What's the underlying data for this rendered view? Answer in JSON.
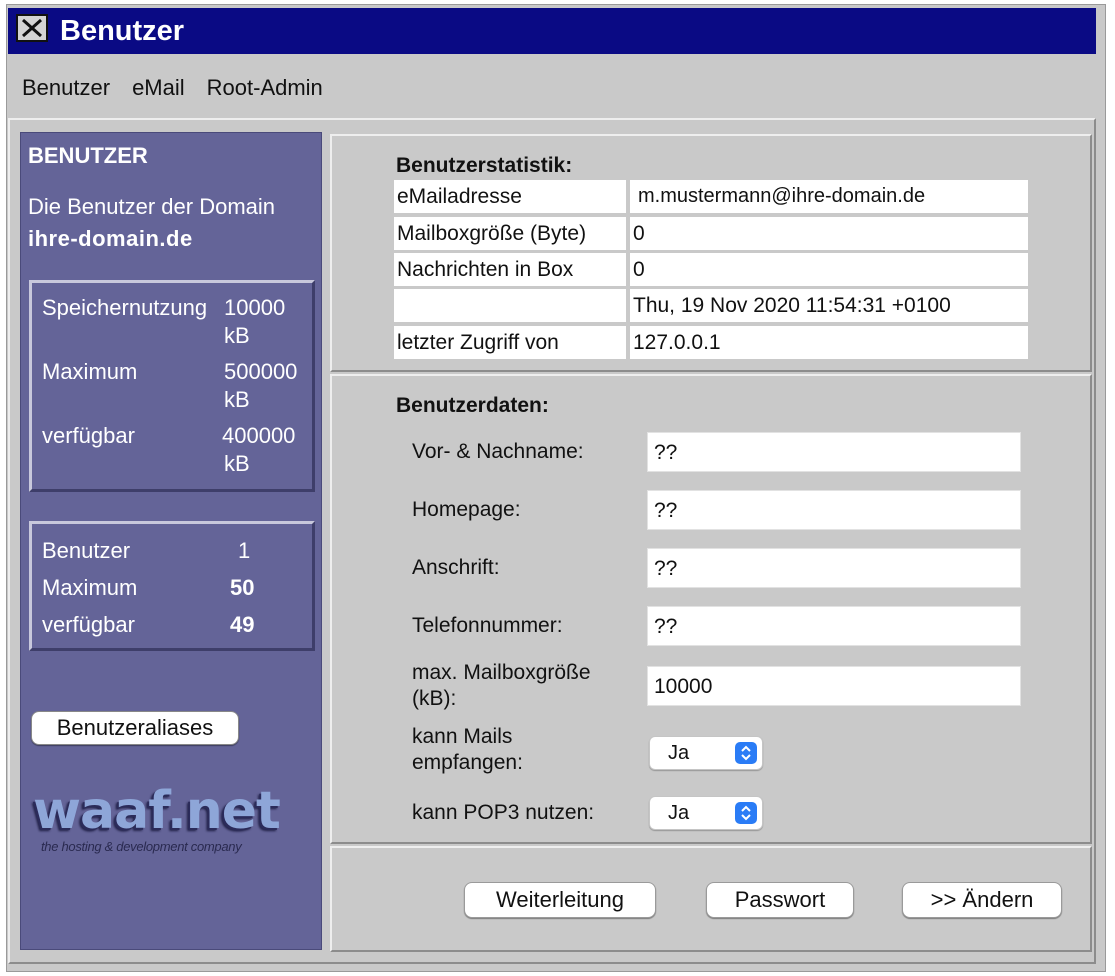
{
  "window": {
    "title": "Benutzer",
    "close_icon": "close-box-icon"
  },
  "menubar": {
    "items": [
      "Benutzer",
      "eMail",
      "Root-Admin"
    ]
  },
  "sidebar": {
    "heading": "BENUTZER",
    "description": "Die Benutzer der Domain",
    "domain": "ihre-domain.de",
    "storage": [
      {
        "label": "Speichernutzung",
        "value": "10000",
        "unit": "kB"
      },
      {
        "label": "Maximum",
        "value": "500000",
        "unit": "kB"
      },
      {
        "label": "verfügbar",
        "value": "400000",
        "unit": "kB"
      }
    ],
    "users": [
      {
        "label": "Benutzer",
        "value": "1"
      },
      {
        "label": "Maximum",
        "value": "50"
      },
      {
        "label": "verfügbar",
        "value": "49"
      }
    ],
    "alias_button": "Benutzeraliases",
    "logo": {
      "text": "waaf.net",
      "tagline": "the hosting & development company"
    }
  },
  "stats": {
    "title": "Benutzerstatistik:",
    "rows": [
      {
        "label": "eMailadresse",
        "value": "m.mustermann@ihre-domain.de"
      },
      {
        "label": "Mailboxgröße (Byte)",
        "value": "0"
      },
      {
        "label": "Nachrichten in Box",
        "value": "0"
      },
      {
        "label": "",
        "value": "Thu, 19 Nov 2020 11:54:31 +0100"
      },
      {
        "label": "letzter Zugriff von",
        "value": "127.0.0.1"
      }
    ]
  },
  "userdata": {
    "title": "Benutzerdaten:",
    "fields": [
      {
        "label": "Vor- & Nachname:",
        "value": "??"
      },
      {
        "label": "Homepage:",
        "value": "??"
      },
      {
        "label": "Anschrift:",
        "value": "??"
      },
      {
        "label": "Telefonnummer:",
        "value": "??"
      },
      {
        "label": "max. Mailboxgröße (kB):",
        "value": "10000"
      }
    ],
    "selects": [
      {
        "label": "kann Mails empfangen:",
        "value": "Ja"
      },
      {
        "label": "kann POP3 nutzen:",
        "value": "Ja"
      }
    ]
  },
  "buttons": {
    "forward": "Weiterleitung",
    "password": "Passwort",
    "change": ">> Ändern"
  },
  "colors": {
    "titlebar": "#0a0a84",
    "sidebar": "#646498",
    "window": "#c9c9c9",
    "select_accent": "#2a7cf6"
  }
}
